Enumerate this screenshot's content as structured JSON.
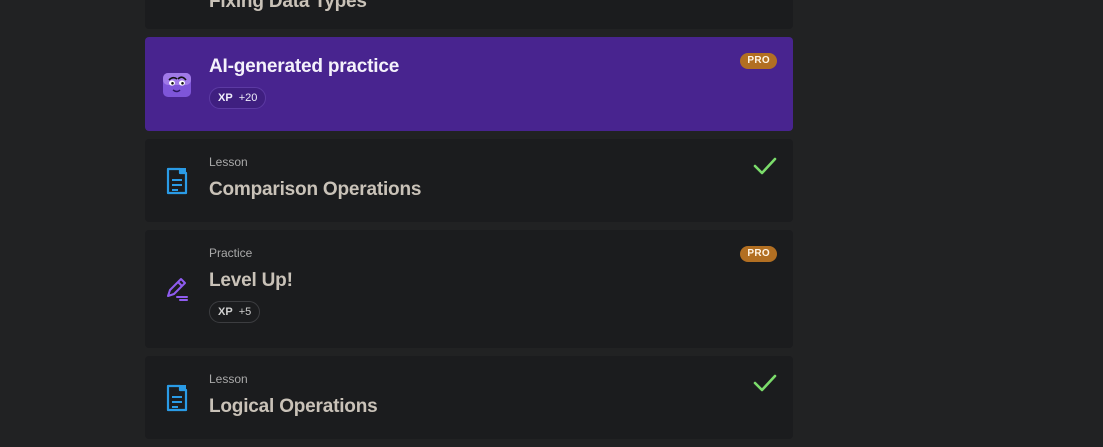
{
  "items": [
    {
      "title": "Fixing Data Types"
    },
    {
      "title": "AI-generated practice",
      "xp_label": "XP",
      "xp_value": "+20",
      "badge": "PRO",
      "icon": "robot-mascot-icon"
    },
    {
      "kind": "Lesson",
      "title": "Comparison Operations",
      "status": "completed",
      "icon": "document-lesson-icon"
    },
    {
      "kind": "Practice",
      "title": "Level Up!",
      "xp_label": "XP",
      "xp_value": "+5",
      "badge": "PRO",
      "icon": "pencil-practice-icon"
    },
    {
      "kind": "Lesson",
      "title": "Logical Operations",
      "status": "completed",
      "icon": "document-lesson-icon"
    }
  ],
  "colors": {
    "background": "#212223",
    "card": "#1b1c1e",
    "ai_card": "#48248f",
    "pro_badge": "#b26f22",
    "check": "#7bdc6b",
    "lesson_icon": "#2a9be6",
    "practice_icon": "#8f5cf0"
  }
}
